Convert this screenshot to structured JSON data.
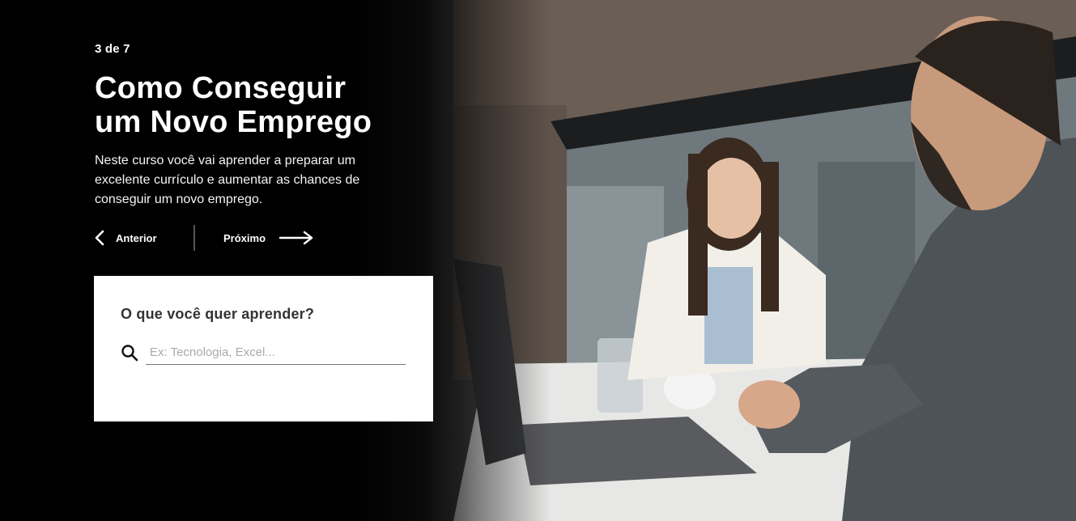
{
  "slide": {
    "counter": "3 de 7",
    "title_line1": "Como Conseguir",
    "title_line2": "um Novo Emprego",
    "description": "Neste curso você vai aprender a preparar um excelente currículo e aumentar as chances de conseguir um novo emprego."
  },
  "nav": {
    "prev_label": "Anterior",
    "next_label": "Próximo"
  },
  "search": {
    "title": "O que você quer aprender?",
    "placeholder": "Ex: Tecnologia, Excel..."
  },
  "icons": {
    "prev": "chevron-left-icon",
    "next": "arrow-right-icon",
    "search": "search-icon"
  },
  "colors": {
    "background": "#000000",
    "card": "#ffffff",
    "card_title": "#333333"
  }
}
